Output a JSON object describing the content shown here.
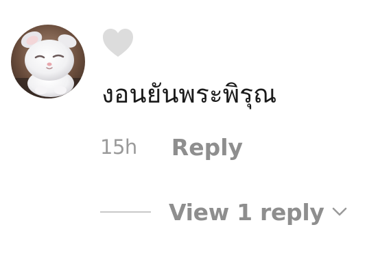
{
  "comment": {
    "avatar_icon": "white-cat-avatar",
    "like_icon": "heart-outline-icon",
    "text": "งอนยันพระพิรุณ",
    "time": "15h",
    "reply_label": "Reply"
  },
  "replies": {
    "view_label": "View 1 reply",
    "toggle_icon": "chevron-down-icon"
  },
  "colors": {
    "text": "#1a1a1a",
    "muted": "#8e8e8e",
    "heart": "#dcdcdc",
    "divider": "#c8c8c8"
  }
}
